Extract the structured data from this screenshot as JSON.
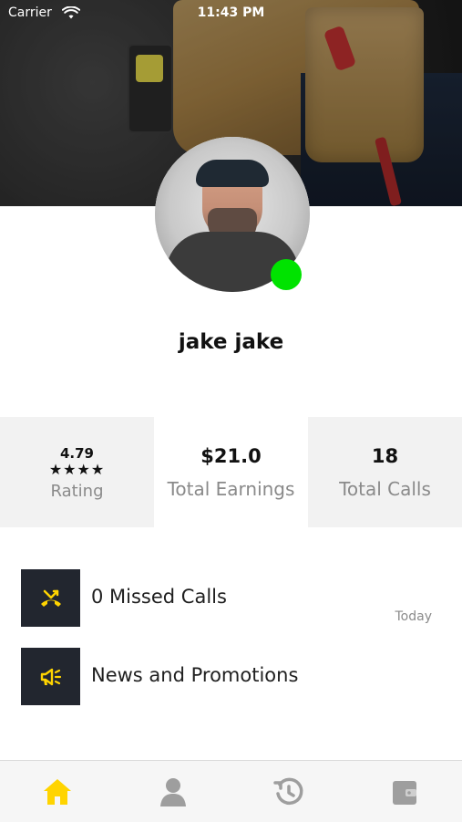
{
  "status_bar": {
    "carrier": "Carrier",
    "time": "11:43 PM"
  },
  "profile": {
    "name": "jake jake",
    "online": true
  },
  "stats": {
    "rating_value": "4.79",
    "rating_stars": "★★★★",
    "rating_label": "Rating",
    "earnings_value": "$21.0",
    "earnings_label": "Total Earnings",
    "calls_value": "18",
    "calls_label": "Total Calls"
  },
  "list": {
    "items": [
      {
        "label": "0 Missed Calls",
        "meta": "Today",
        "icon": "missed-call-icon"
      },
      {
        "label": "News and Promotions",
        "meta": "",
        "icon": "megaphone-icon"
      }
    ]
  },
  "bottom_nav": {
    "items": [
      {
        "icon": "home-icon",
        "active": true
      },
      {
        "icon": "profile-icon",
        "active": false
      },
      {
        "icon": "history-icon",
        "active": false
      },
      {
        "icon": "wallet-icon",
        "active": false
      }
    ]
  },
  "colors": {
    "accent": "#ffd400",
    "online": "#00e300",
    "dark": "#22262f",
    "muted": "#8a8a8a",
    "nav_inactive": "#9e9e9e"
  }
}
